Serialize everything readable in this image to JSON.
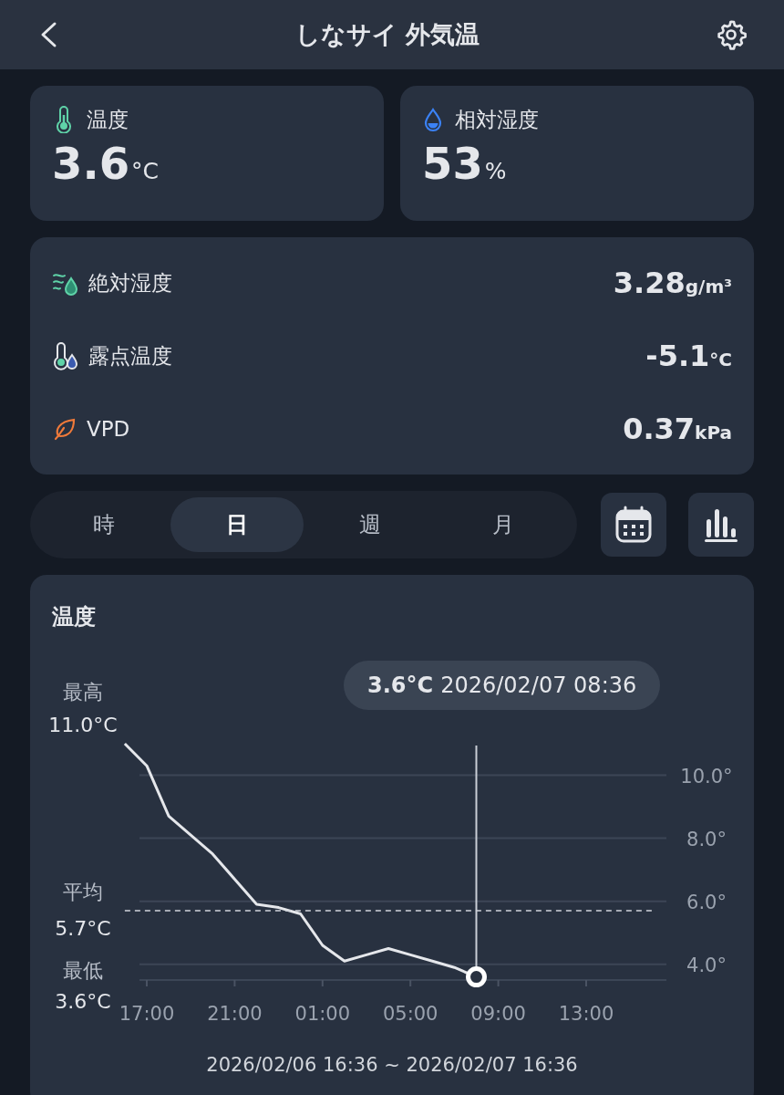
{
  "header": {
    "title": "しなサイ 外気温"
  },
  "top_cards": [
    {
      "kind": "temperature",
      "label": "温度",
      "value": "3.6",
      "unit": "°C"
    },
    {
      "kind": "humidity",
      "label": "相対湿度",
      "value": "53",
      "unit": "%"
    }
  ],
  "metrics": [
    {
      "kind": "absolute",
      "label": "絶対湿度",
      "value": "3.28",
      "unit": "g/m³"
    },
    {
      "kind": "dewpoint",
      "label": "露点温度",
      "value": "-5.1",
      "unit": "°C"
    },
    {
      "kind": "vpd",
      "label": "VPD",
      "value": "0.37",
      "unit": "kPa"
    }
  ],
  "period_tabs": [
    {
      "label": "時",
      "selected": false
    },
    {
      "label": "日",
      "selected": true
    },
    {
      "label": "週",
      "selected": false
    },
    {
      "label": "月",
      "selected": false
    }
  ],
  "chart_card": {
    "tooltip_value": "3.6°C",
    "tooltip_time": "2026/02/07 08:36",
    "stats": [
      {
        "kind": "max",
        "label": "最高",
        "value": "11.0°C"
      },
      {
        "kind": "avg",
        "value": "5.7°C"
      },
      {
        "kind": "min",
        "label": "最低",
        "value": "3.6°C"
      }
    ],
    "chart_data": {
      "type": "line",
      "title": "温度",
      "categories": [
        null,
        "17:00",
        null,
        null,
        null,
        "21:00",
        null,
        null,
        null,
        "01:00",
        null,
        null,
        null,
        "05:00",
        null,
        null,
        null,
        "09:00",
        null,
        null,
        null,
        "13:00",
        null,
        null,
        null
      ],
      "series": [
        {
          "color": "#e5e7eb",
          "values": [
            11.0,
            10.3,
            8.7,
            8.1,
            7.5,
            6.7,
            5.9,
            5.8,
            5.6,
            4.6,
            4.1,
            4.3,
            4.5,
            4.3,
            4.1,
            3.9,
            3.6,
            null,
            null,
            null,
            null,
            null,
            null,
            null,
            null
          ]
        },
        {
          "name": "平均",
          "color": "#d1d5db",
          "line_style": "dashed",
          "values": [
            5.7,
            5.7,
            5.7,
            5.7,
            5.7,
            5.7,
            5.7,
            5.7,
            5.7,
            5.7,
            5.7,
            5.7,
            5.7,
            5.7,
            5.7,
            5.7,
            5.7,
            5.7,
            5.7,
            5.7,
            5.7,
            5.7,
            5.7,
            5.7,
            5.7
          ]
        }
      ],
      "grid": true,
      "ylim": [
        3.5,
        11.0
      ],
      "yticks": [
        {
          "value": 10,
          "label": "10.0°"
        },
        {
          "value": 8,
          "label": "8.0°"
        },
        {
          "value": 6,
          "label": "6.0°"
        },
        {
          "value": 4,
          "label": "4.0°"
        }
      ]
    },
    "range": "2026/02/06 16:36 ~ 2026/02/07 16:36"
  }
}
